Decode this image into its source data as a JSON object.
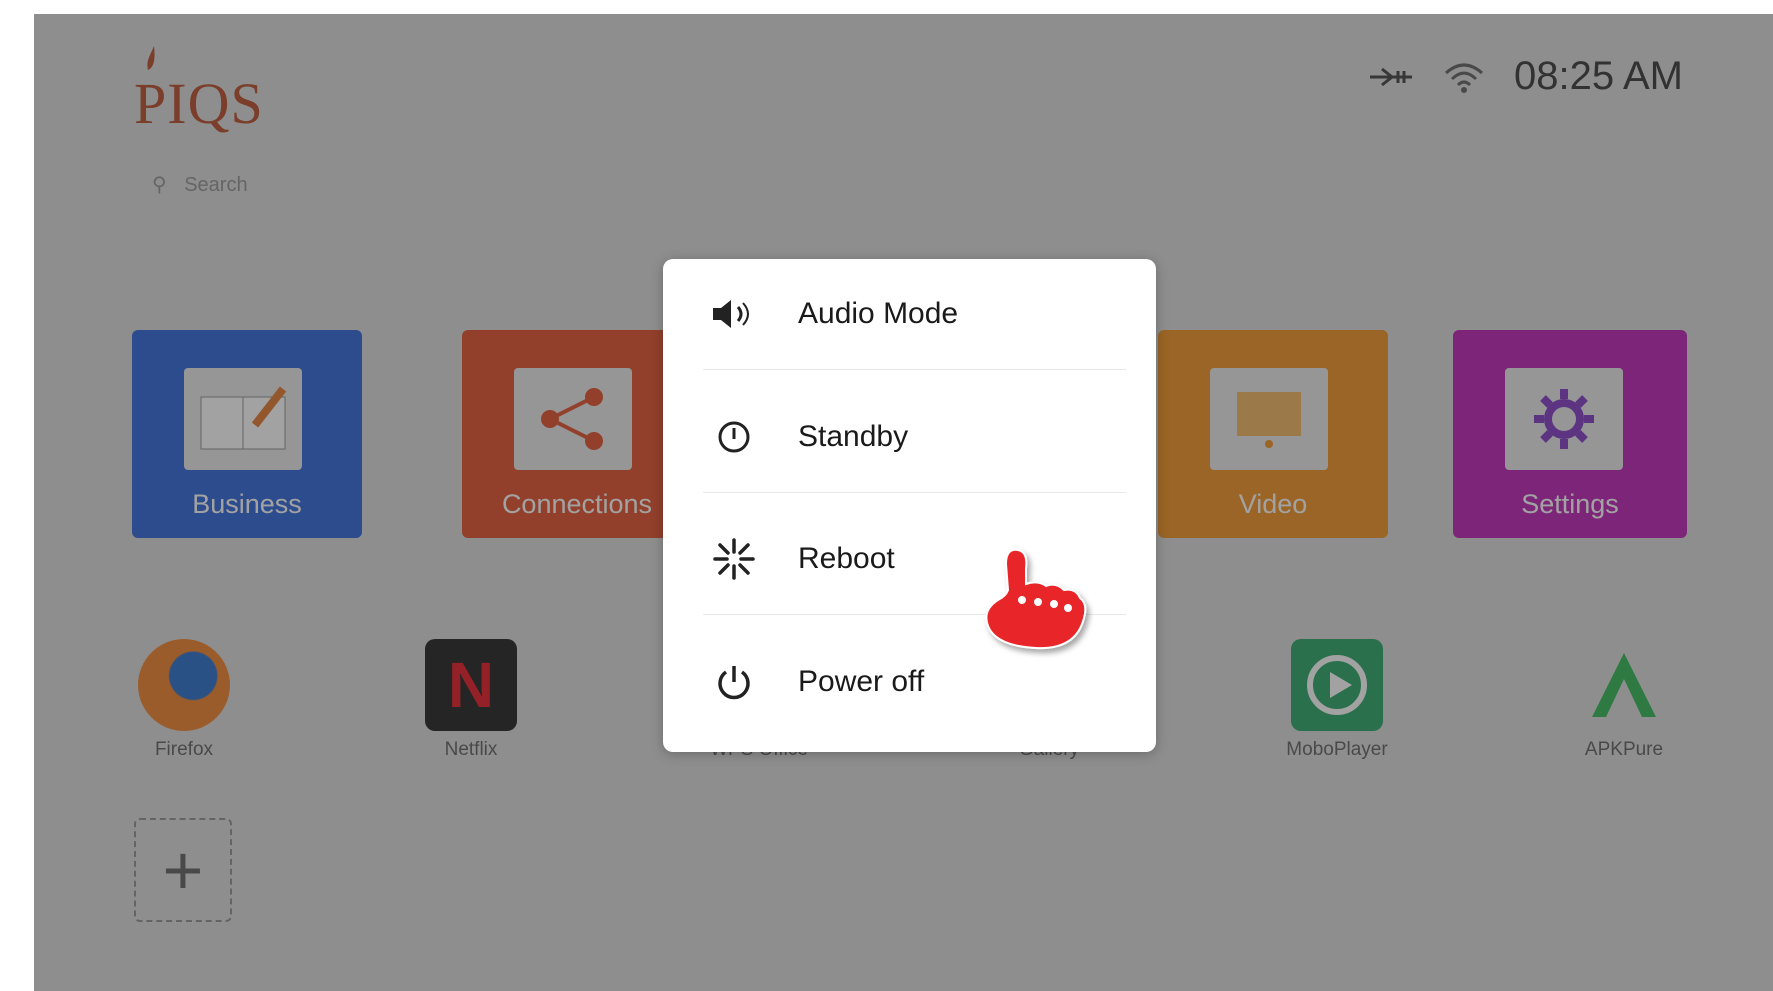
{
  "header": {
    "brand": "PIQS",
    "clock": "08:25 AM",
    "search_hint": "Search"
  },
  "tiles": [
    {
      "label": "Business",
      "color": "#1e5bd8"
    },
    {
      "label": "Connections",
      "color": "#e0441c"
    },
    {
      "label": "Video",
      "color": "#f08a12"
    },
    {
      "label": "Settings",
      "color": "#b812b0"
    }
  ],
  "apps": [
    {
      "label": "Firefox"
    },
    {
      "label": "Netflix"
    },
    {
      "label": "WPS Office"
    },
    {
      "label": "Gallery"
    },
    {
      "label": "MoboPlayer"
    },
    {
      "label": "APKPure"
    }
  ],
  "dialog": {
    "items": [
      {
        "label": "Audio Mode",
        "icon": "speaker-icon"
      },
      {
        "label": "Standby",
        "icon": "standby-icon"
      },
      {
        "label": "Reboot",
        "icon": "reboot-icon"
      },
      {
        "label": "Power off",
        "icon": "power-icon"
      }
    ]
  },
  "colors": {
    "accent_pointer": "#e8262c",
    "brand": "#b3401c"
  }
}
